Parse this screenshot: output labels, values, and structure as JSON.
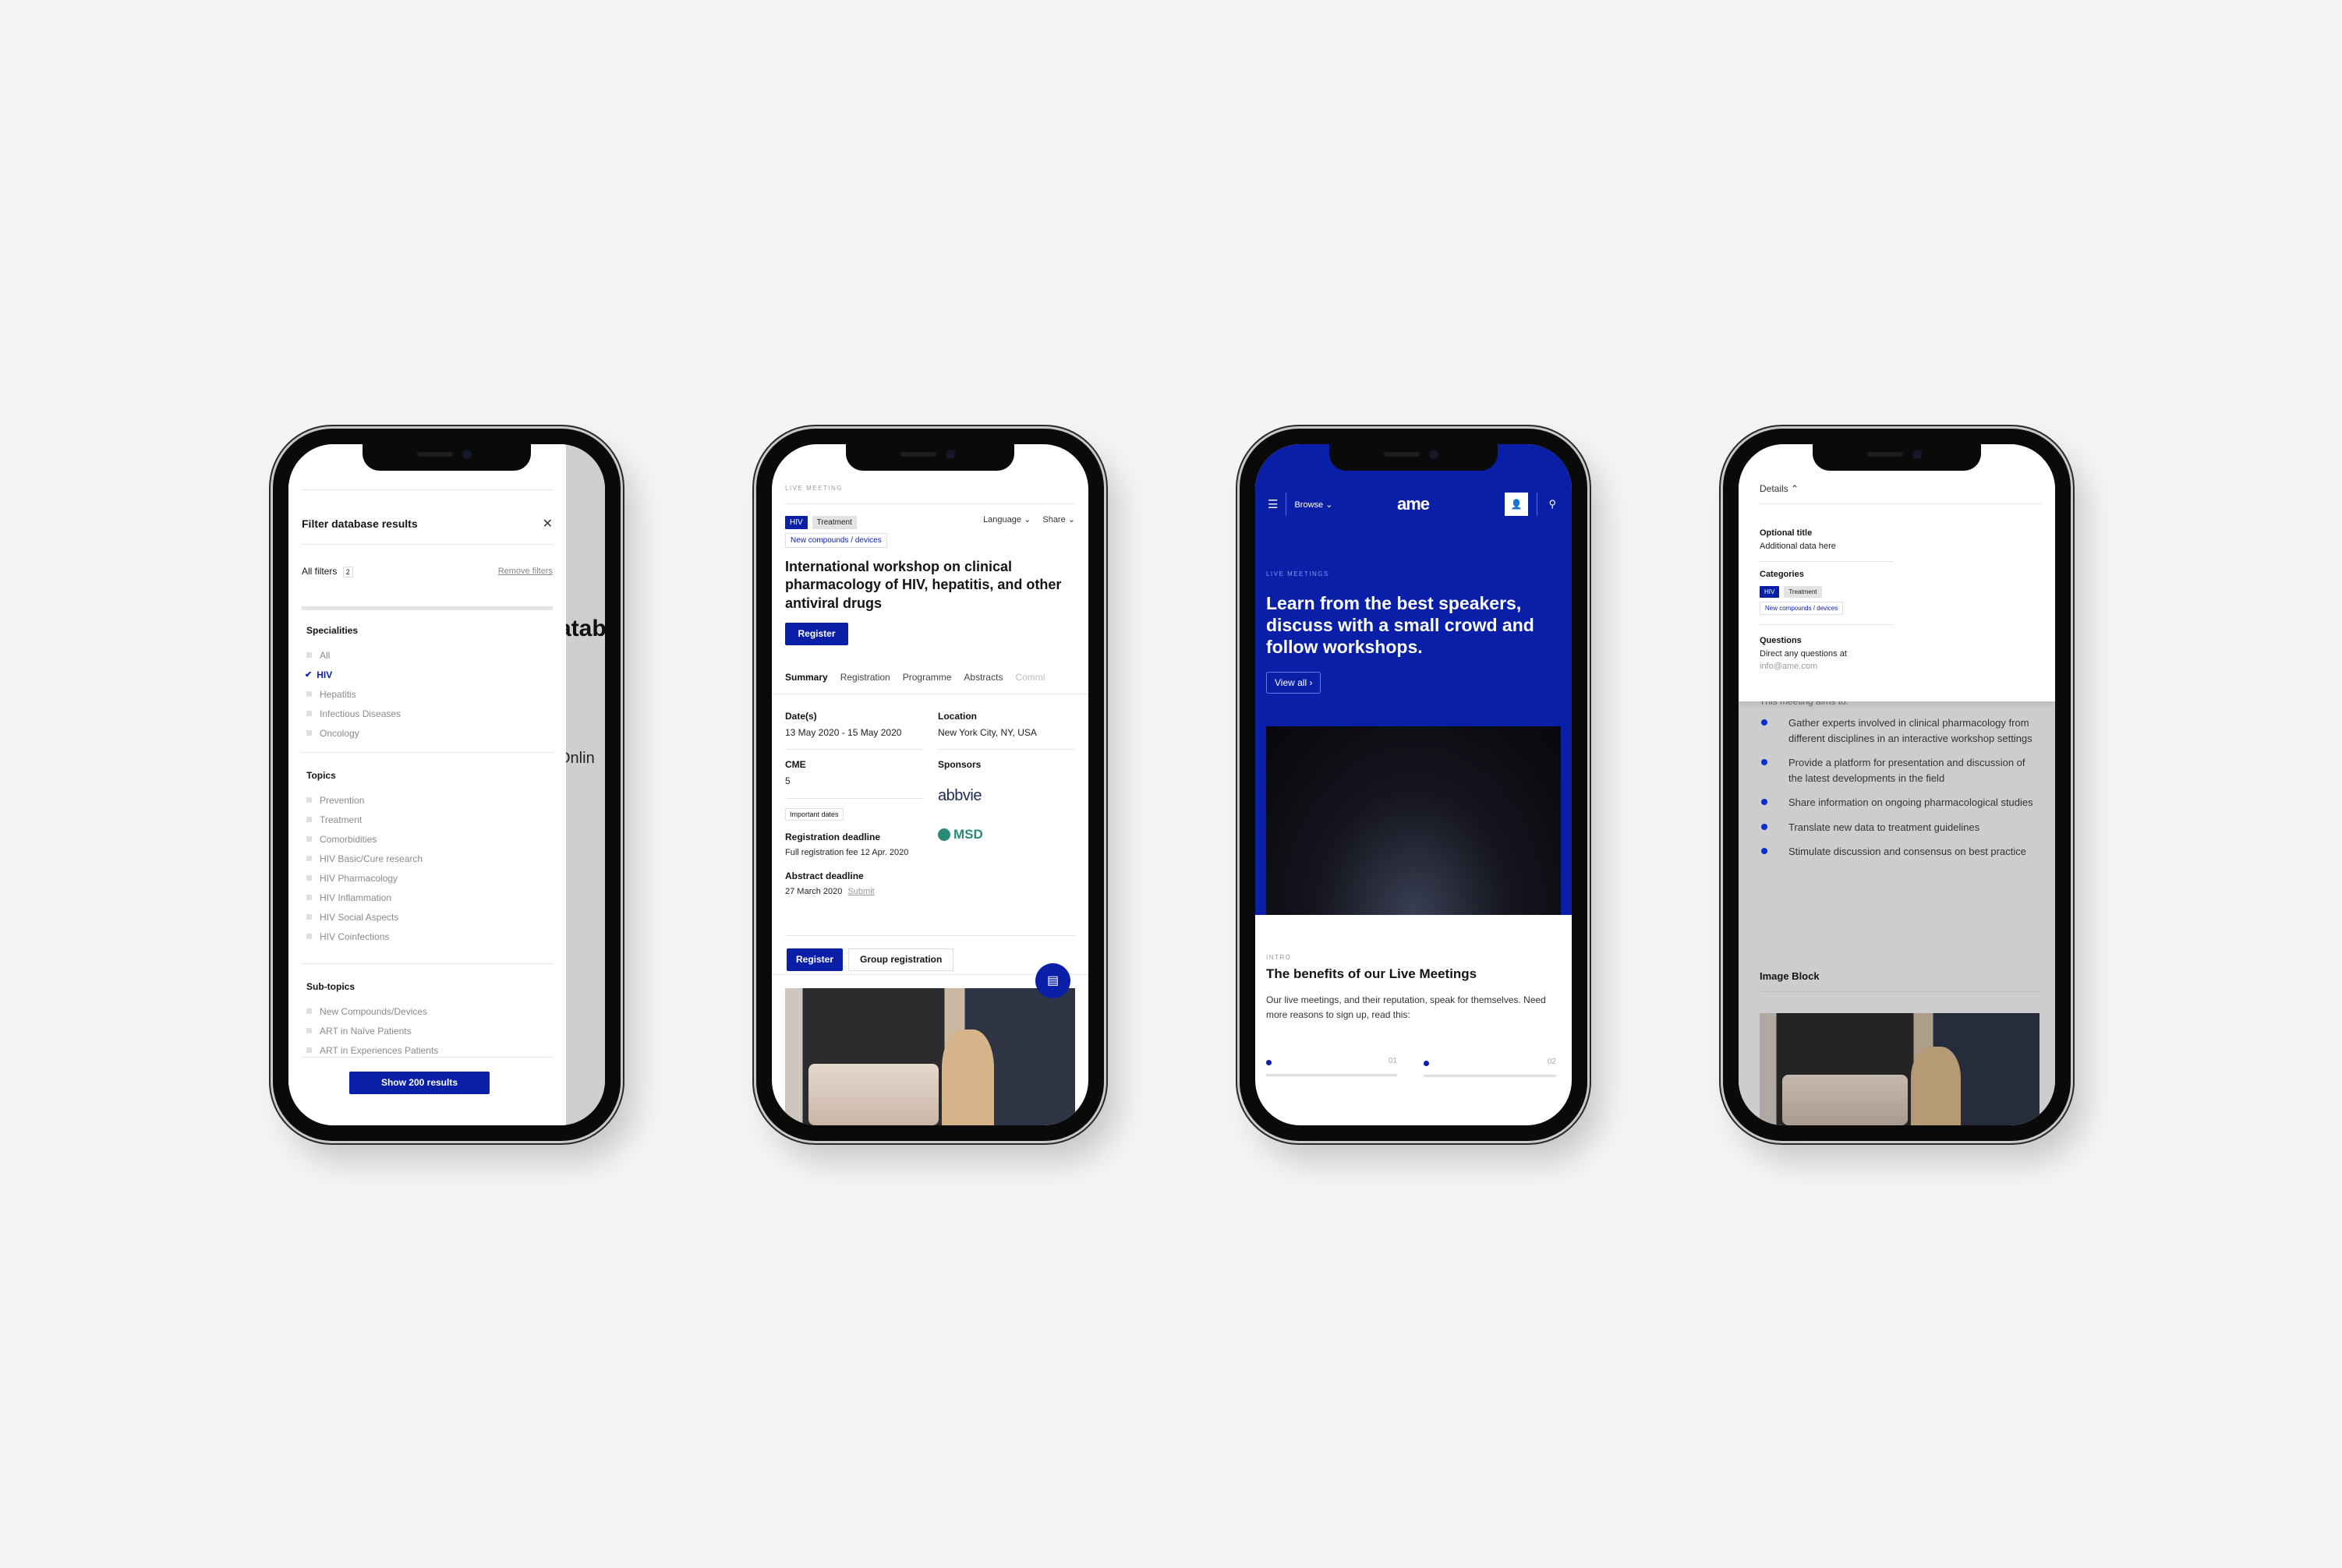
{
  "colors": {
    "brand_blue": "#0a1fa8",
    "background": "#f4f4f4"
  },
  "phone1": {
    "background_partial_texts": [
      "atab",
      "Onlin"
    ],
    "title": "Filter database results",
    "close_icon": "close-icon",
    "all_filters_label": "All filters",
    "all_filters_count": "2",
    "remove_filters": "Remove filters",
    "sections": [
      {
        "title": "Specialities",
        "items": [
          {
            "label": "All",
            "checked": false
          },
          {
            "label": "HIV",
            "checked": true
          },
          {
            "label": "Hepatitis",
            "checked": false
          },
          {
            "label": "Infectious Diseases",
            "checked": false
          },
          {
            "label": "Oncology",
            "checked": false
          }
        ]
      },
      {
        "title": "Topics",
        "items": [
          {
            "label": "Prevention",
            "checked": false
          },
          {
            "label": "Treatment",
            "checked": false
          },
          {
            "label": "Comorbidities",
            "checked": false
          },
          {
            "label": "HIV Basic/Cure research",
            "checked": false
          },
          {
            "label": "HIV Pharmacology",
            "checked": false
          },
          {
            "label": "HIV Inflammation",
            "checked": false
          },
          {
            "label": "HIV Social Aspects",
            "checked": false
          },
          {
            "label": "HIV Coinfections",
            "checked": false
          }
        ]
      },
      {
        "title": "Sub-topics",
        "items": [
          {
            "label": "New Compounds/Devices",
            "checked": false
          },
          {
            "label": "ART in Naïve Patients",
            "checked": false
          },
          {
            "label": "ART in Experiences Patients",
            "checked": false
          }
        ]
      }
    ],
    "show_results_button": "Show 200 results"
  },
  "phone2": {
    "eyebrow": "LIVE MEETING",
    "tags": {
      "hiv": "HIV",
      "treatment": "Treatment",
      "new": "New compounds / devices"
    },
    "language": "Language",
    "share": "Share",
    "title": "International workshop on clinical pharmacology of HIV, hepatitis, and other antiviral drugs",
    "register": "Register",
    "tabs": [
      "Summary",
      "Registration",
      "Programme",
      "Abstracts",
      "Commi"
    ],
    "active_tab": "Summary",
    "dates_label": "Date(s)",
    "dates_value": "13 May 2020 - 15 May 2020",
    "location_label": "Location",
    "location_value": "New York City, NY, USA",
    "cme_label": "CME",
    "cme_value": "5",
    "sponsors_label": "Sponsors",
    "sponsors": [
      "abbvie",
      "MSD"
    ],
    "important_dates": "Important dates",
    "reg_deadline_label": "Registration deadline",
    "reg_deadline_value": "Full registration fee 12 Apr. 2020",
    "abstract_label": "Abstract deadline",
    "abstract_value": "27 March 2020",
    "submit": "Submit",
    "register2": "Register",
    "group_registration": "Group registration",
    "chat_icon": "chat-icon"
  },
  "phone3": {
    "browse": "Browse",
    "logo": "ame",
    "eyebrow": "LIVE MEETINGS",
    "headline": "Learn from the best speakers, discuss with a small crowd and follow workshops.",
    "view_all": "View all",
    "intro_eyebrow": "INTRO",
    "intro_title": "The benefits of our Live Meetings",
    "intro_body": "Our live meetings, and their reputation, speak for themselves. Need more reasons to sign up, read this:",
    "carousel": [
      {
        "num": "01"
      },
      {
        "num": "02"
      }
    ]
  },
  "phone4": {
    "details": "Details",
    "optional_title": "Optional title",
    "optional_value": "Additional data here",
    "categories": "Categories",
    "tags": {
      "hiv": "HIV",
      "treatment": "Treatment",
      "new": "New compounds / devices"
    },
    "questions": "Questions",
    "questions_text": "Direct any questions at",
    "email": "info@ame.com",
    "aims_intro": "This meeting aims to:",
    "aims": [
      "Gather experts involved in clinical pharmacology from different disciplines in an interactive workshop settings",
      "Provide a platform for presentation and discussion of the latest developments in the field",
      "Share information on ongoing pharmacological studies",
      "Translate new data to treatment guidelines",
      "Stimulate discussion and consensus on best practice"
    ],
    "image_block": "Image Block"
  }
}
